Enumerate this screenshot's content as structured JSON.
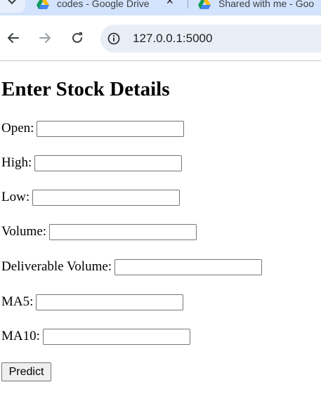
{
  "browser": {
    "tabs": [
      {
        "title": "codes - Google Drive",
        "close_glyph": "✕"
      },
      {
        "title": "Shared with me - Goo"
      }
    ],
    "address_bar": {
      "url": "127.0.0.1:5000"
    },
    "icons": {
      "back": "arrow-left",
      "forward": "arrow-right",
      "reload": "reload",
      "site_info": "info"
    }
  },
  "page": {
    "heading": "Enter Stock Details",
    "fields": [
      {
        "label": "Open:",
        "value": ""
      },
      {
        "label": "High:",
        "value": ""
      },
      {
        "label": "Low:",
        "value": ""
      },
      {
        "label": "Volume:",
        "value": ""
      },
      {
        "label": "Deliverable Volume:",
        "value": ""
      },
      {
        "label": "MA5:",
        "value": ""
      },
      {
        "label": "MA10:",
        "value": ""
      }
    ],
    "submit_label": "Predict"
  }
}
